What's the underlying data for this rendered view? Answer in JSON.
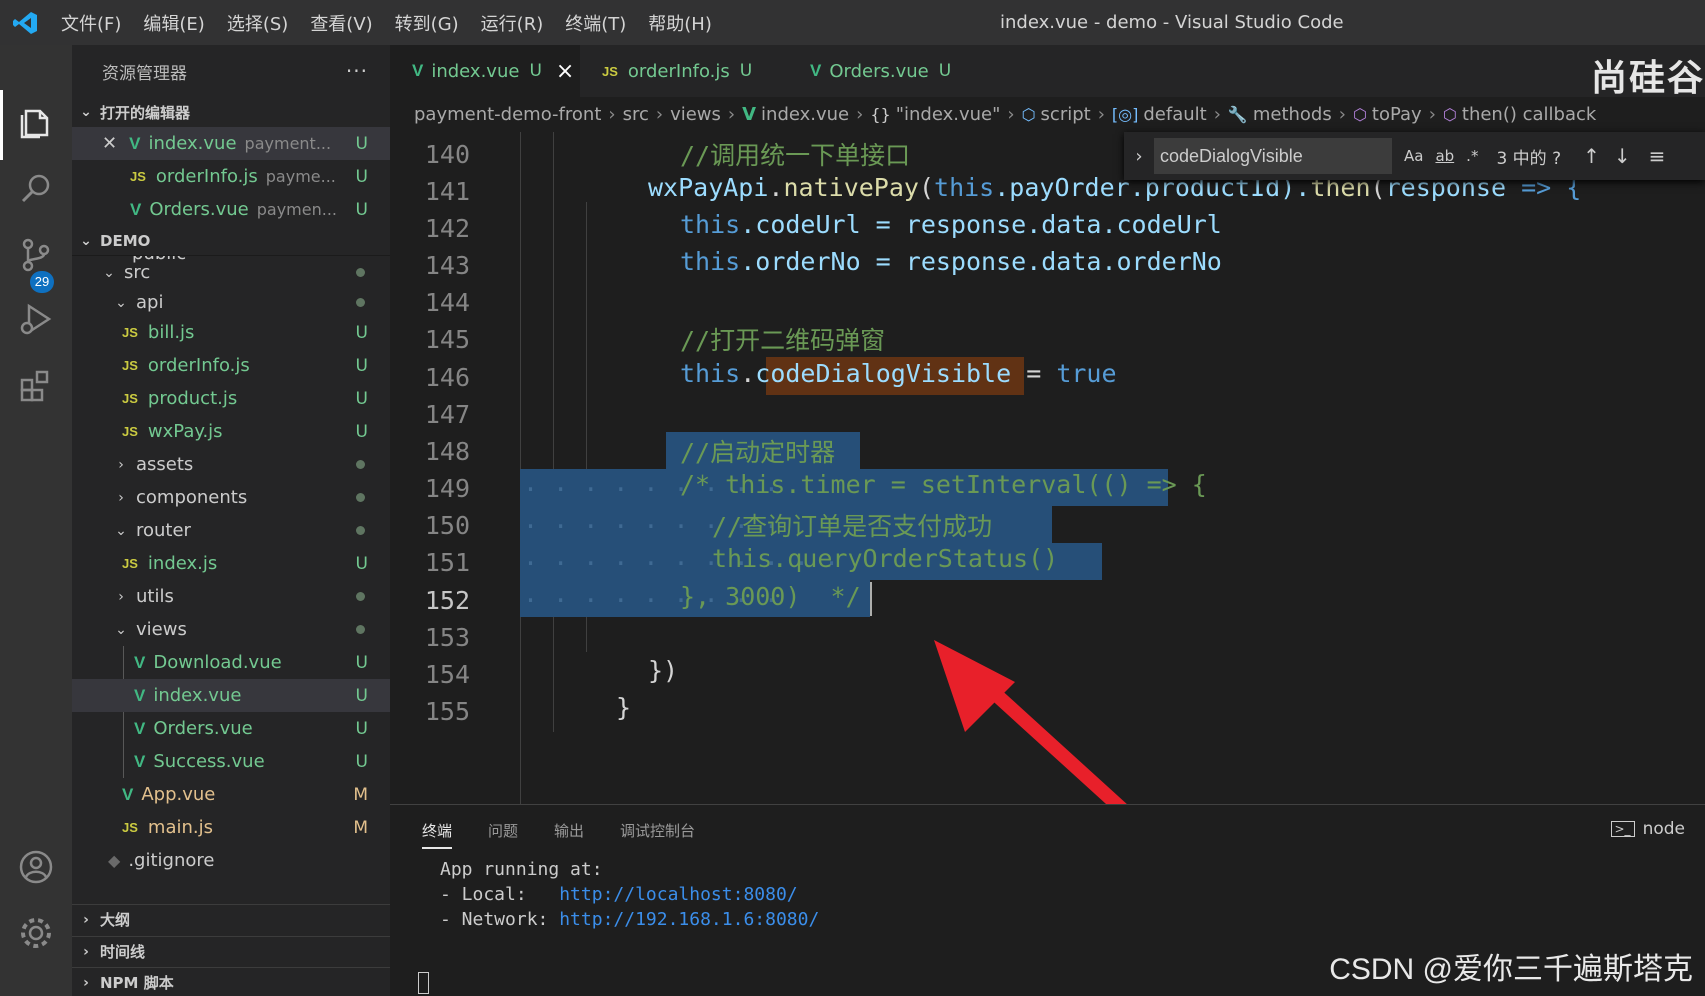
{
  "window": {
    "title": "index.vue - demo - Visual Studio Code",
    "menus": [
      "文件(F)",
      "编辑(E)",
      "选择(S)",
      "查看(V)",
      "转到(G)",
      "运行(R)",
      "终端(T)",
      "帮助(H)"
    ]
  },
  "activity_bar": {
    "scm_badge": "29",
    "icons": [
      "files-icon",
      "search-icon",
      "source-control-icon",
      "run-debug-icon",
      "extensions-icon",
      "account-icon",
      "settings-gear-icon"
    ]
  },
  "sidebar": {
    "title": "资源管理器",
    "more": "···",
    "open_editors": {
      "header": "打开的编辑器",
      "items": [
        {
          "name": "index.vue",
          "path": "payment...",
          "status": "U"
        },
        {
          "name": "orderInfo.js",
          "path": "payme...",
          "status": "U"
        },
        {
          "name": "Orders.vue",
          "path": "paymen...",
          "status": "U"
        }
      ]
    },
    "demo_header": "DEMO",
    "tree": {
      "partial": "public",
      "src": "src",
      "api": "api",
      "bill": "bill.js",
      "orderInfo": "orderInfo.js",
      "product": "product.js",
      "wxPay": "wxPay.js",
      "assets": "assets",
      "components": "components",
      "router": "router",
      "router_index": "index.js",
      "utils": "utils",
      "views": "views",
      "download": "Download.vue",
      "views_index": "index.vue",
      "orders": "Orders.vue",
      "success": "Success.vue",
      "app": "App.vue",
      "main": "main.js",
      "gitignore": ".gitignore",
      "status_u": "U",
      "status_m": "M"
    },
    "outline_header": "大纲",
    "timeline_header": "时间线",
    "npm_header": "NPM 脚本"
  },
  "tabs": [
    {
      "label": "index.vue",
      "status": "U",
      "close": "×"
    },
    {
      "label": "orderInfo.js",
      "status": "U"
    },
    {
      "label": "Orders.vue",
      "status": "U"
    }
  ],
  "brand_mark": "尚硅谷",
  "breadcrumb": {
    "project": "payment-demo-front",
    "src": "src",
    "views": "views",
    "file": "index.vue",
    "module": "\"index.vue\"",
    "script": "script",
    "default": "default",
    "methods": "methods",
    "toPay": "toPay",
    "callback": "then() callback"
  },
  "find_widget": {
    "value": "codeDialogVisible",
    "opt_case": "Aa",
    "opt_word": "ab",
    "opt_regex": ".*",
    "count": "3 中的 ?",
    "up": "↑",
    "down": "↓",
    "menu": "≡"
  },
  "code": {
    "line_numbers": [
      "140",
      "141",
      "142",
      "143",
      "144",
      "145",
      "146",
      "147",
      "148",
      "149",
      "150",
      "151",
      "152",
      "153",
      "154",
      "155"
    ],
    "l140": "//调用统一下单接口",
    "l141a": "wxPayApi",
    "l141b": ".",
    "l141c": "nativePay",
    "l141d": "(",
    "l141e": "this",
    "l141f": ".payOrder.productId).",
    "l141g": "then",
    "l141h": "(",
    "l141i": "response",
    "l141j": " => {",
    "l142a": "this",
    "l142b": ".codeUrl = response.data.codeUrl",
    "l143a": "this",
    "l143b": ".orderNo = response.data.orderNo",
    "l145": "//打开二维码弹窗",
    "l146a": "this",
    "l146b": ".",
    "l146c": "codeDialogVisible",
    "l146d": " = ",
    "l146e": "true",
    "l148": "//启动定时器",
    "l149": "/* this.timer = setInterval(() => {",
    "l150": "//查询订单是否支付成功",
    "l151": "this.queryOrderStatus()",
    "l152": "}, 3000)  */",
    "l154": "})",
    "l155": "}"
  },
  "panel": {
    "tabs": [
      "终端",
      "问题",
      "输出",
      "调试控制台"
    ],
    "terminal_type": "node",
    "lines": {
      "running": "App running at:",
      "local_label": "- Local:   ",
      "local_url": "http://localhost:8080/",
      "network_label": "- Network: ",
      "network_url": "http://192.168.1.6:8080/"
    }
  },
  "watermark": "CSDN @爱你三千遍斯塔克",
  "colors": {
    "accent_selection": "#264f78",
    "find_highlight": "#613214",
    "annotation_arrow": "#e8202a",
    "git_untracked": "#73c991",
    "git_modified": "#e2c08d"
  }
}
